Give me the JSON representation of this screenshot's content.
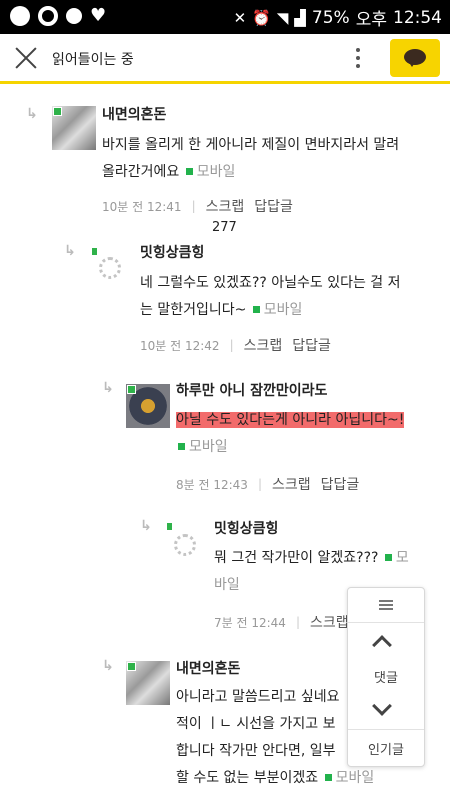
{
  "status_bar": {
    "battery": "75%",
    "ampm": "오후",
    "time": "12:54"
  },
  "header": {
    "title": "읽어들이는 중"
  },
  "comments": [
    {
      "name": "내면의혼돈",
      "body_line1": "바지를 올리게 한 게아니라 제질이 면바지라서 말려",
      "body_line2": "올라간거에요",
      "mobile": "모바일",
      "time": "10분 전 12:41",
      "scrap": "스크랩",
      "reply": "답답글",
      "count": "277"
    },
    {
      "name": "밋힝상큼힝",
      "body_line1": "네 그럴수도 있겠죠?? 아닐수도 있다는 걸 저",
      "body_line2": "는 말한거입니다~",
      "mobile": "모바일",
      "time": "10분 전 12:42",
      "scrap": "스크랩",
      "reply": "답답글"
    },
    {
      "name": "하루만 아니 잠깐만이라도",
      "body_line1": "아닐 수도 있다는게 아니라 아닙니다~!",
      "mobile": "모바일",
      "time": "8분 전 12:43",
      "scrap": "스크랩",
      "reply": "답답글"
    },
    {
      "name": "밋힝상큼힝",
      "body_line1": "뭐 그건 작가만이 알겠죠???",
      "mobile_part1": "모",
      "mobile_part2": "바일",
      "time": "7분 전 12:44",
      "scrap": "스크랩"
    },
    {
      "name": "내면의혼돈",
      "body_line1": "아니라고 말씀드리고 싶네요",
      "body_line2": "적이 ㅣㄴ 시선을 가지고 보",
      "body_line3": "합니다 작가만 안다면, 일부",
      "body_line4": "할 수도 없는 부분이겠죠",
      "mobile": "모바일"
    }
  ],
  "float_nav": {
    "comments_label": "댓글",
    "popular_label": "인기글"
  },
  "colors": {
    "accent_yellow": "#f7d400",
    "highlight_red": "#f26b6b",
    "mobile_green": "#22b24c"
  }
}
